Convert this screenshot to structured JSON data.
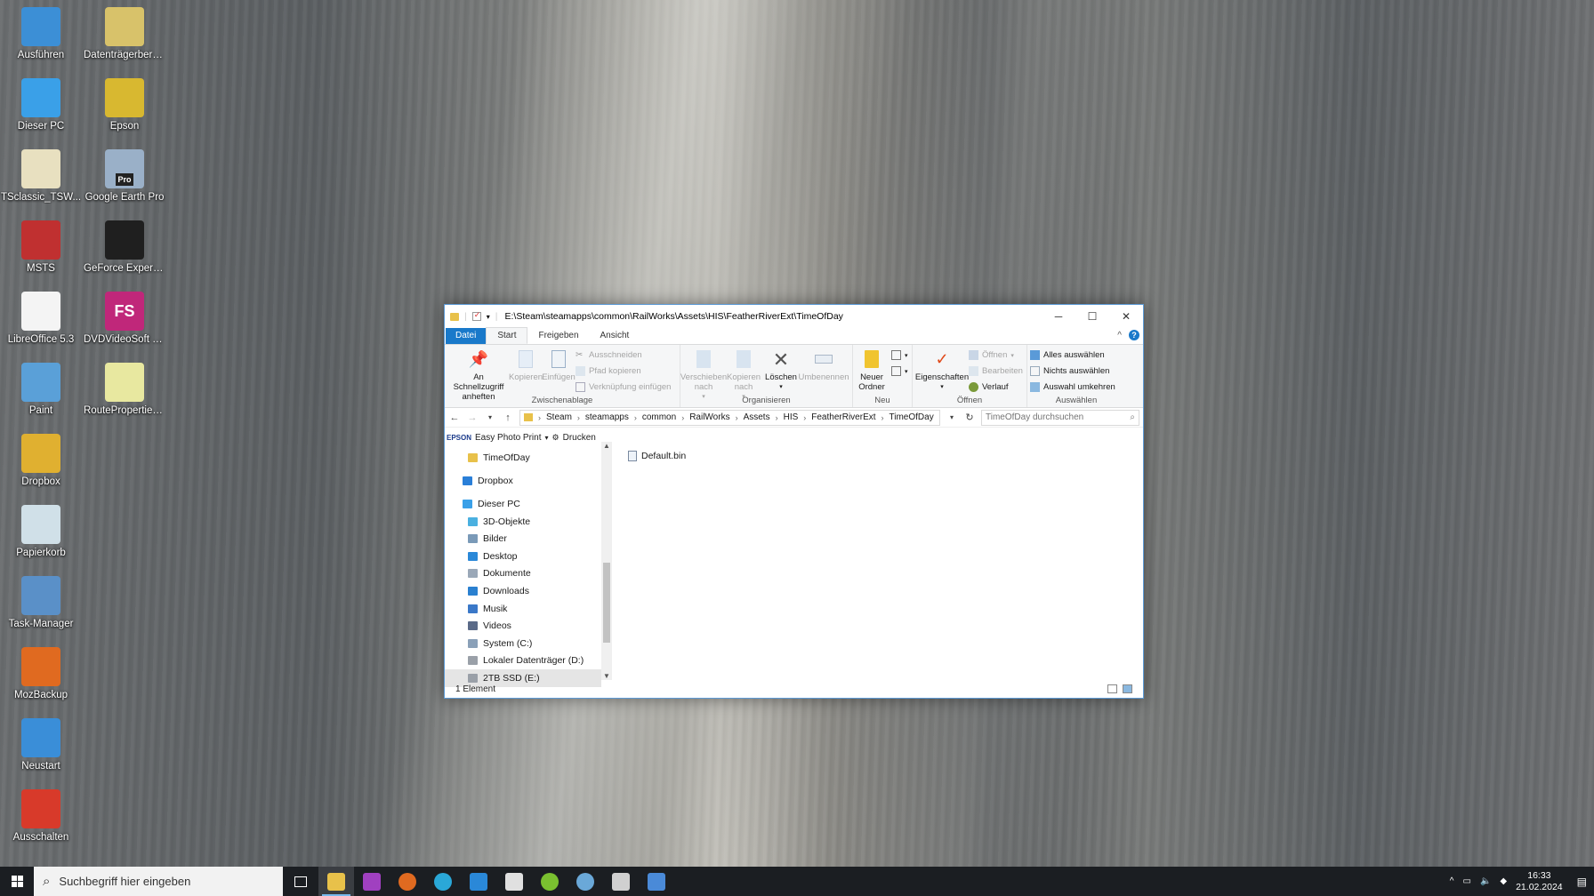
{
  "desktop": {
    "icons": [
      {
        "label": "Ausführen",
        "color": "#3c8fd6"
      },
      {
        "label": "Datenträgerberein...",
        "color": "#d8c26a"
      },
      {
        "label": "Dieser PC",
        "color": "#3aa0e8"
      },
      {
        "label": "Epson",
        "color": "#d8b830"
      },
      {
        "label": "TSclassic_TSW...",
        "color": "#e8e0c0"
      },
      {
        "label": "Google Earth Pro",
        "color": "#9ab0c8"
      },
      {
        "label": "MSTS",
        "color": "#c03030"
      },
      {
        "label": "GeForce Experience",
        "color": "#1f1f1f"
      },
      {
        "label": "LibreOffice 5.3",
        "color": "#f4f4f4"
      },
      {
        "label": "DVDVideoSoft Free Studio",
        "color": "#c0277a"
      },
      {
        "label": "Paint",
        "color": "#5aa0d8"
      },
      {
        "label": "RouteProperties.xml",
        "color": "#e8e8a0"
      },
      {
        "label": "Dropbox",
        "color": "#e0b030"
      },
      {
        "label": "Papierkorb",
        "color": "#d0e0e8"
      },
      {
        "label": "Task-Manager",
        "color": "#5a90c8"
      },
      {
        "label": "MozBackup",
        "color": "#e06a20"
      },
      {
        "label": "Neustart",
        "color": "#3a8ed8"
      },
      {
        "label": "Ausschalten",
        "color": "#d83a2a"
      }
    ],
    "fs_icon_text": "FS",
    "pro_badge": "Pro"
  },
  "window": {
    "title": "E:\\Steam\\steamapps\\common\\RailWorks\\Assets\\HIS\\FeatherRiverExt\\TimeOfDay",
    "tabs": [
      "Datei",
      "Start",
      "Freigeben",
      "Ansicht"
    ],
    "active_tab": "Start",
    "help": "?",
    "ribbon": {
      "clipboard": {
        "name": "Zwischenablage",
        "pin": "An Schnellzugriff anheften",
        "copy": "Kopieren",
        "paste": "Einfügen",
        "cut": "Ausschneiden",
        "copy_path": "Pfad kopieren",
        "paste_shortcut": "Verknüpfung einfügen"
      },
      "organize": {
        "name": "Organisieren",
        "move_to": "Verschieben nach",
        "copy_to": "Kopieren nach",
        "delete": "Löschen",
        "rename": "Umbenennen"
      },
      "new": {
        "name": "Neu",
        "new_folder": "Neuer Ordner"
      },
      "open": {
        "name": "Öffnen",
        "properties": "Eigenschaften",
        "open": "Öffnen",
        "edit": "Bearbeiten",
        "history": "Verlauf"
      },
      "select": {
        "name": "Auswählen",
        "select_all": "Alles auswählen",
        "select_none": "Nichts auswählen",
        "invert": "Auswahl umkehren"
      }
    },
    "address": [
      "Steam",
      "steamapps",
      "common",
      "RailWorks",
      "Assets",
      "HIS",
      "FeatherRiverExt",
      "TimeOfDay"
    ],
    "search_placeholder": "TimeOfDay durchsuchen",
    "epson": {
      "brand": "EPSON",
      "app": "Easy Photo Print",
      "print": "Drucken"
    },
    "nav": [
      {
        "label": "TimeOfDay",
        "icon": "folder-icon",
        "color": "#e8c14a",
        "indent": 1
      },
      {
        "label": "",
        "icon": "",
        "color": "",
        "indent": 0
      },
      {
        "label": "Dropbox",
        "icon": "dropbox-icon",
        "color": "#2a7fd8",
        "indent": 0
      },
      {
        "label": "",
        "icon": "",
        "color": "",
        "indent": 0
      },
      {
        "label": "Dieser PC",
        "icon": "pc-icon",
        "color": "#3aa0e8",
        "indent": 0
      },
      {
        "label": "3D-Objekte",
        "icon": "3d-objects-icon",
        "color": "#4ab0e0",
        "indent": 1
      },
      {
        "label": "Bilder",
        "icon": "pictures-icon",
        "color": "#7a9ab8",
        "indent": 1
      },
      {
        "label": "Desktop",
        "icon": "desktop-icon",
        "color": "#2a88d8",
        "indent": 1
      },
      {
        "label": "Dokumente",
        "icon": "documents-icon",
        "color": "#9aa8b8",
        "indent": 1
      },
      {
        "label": "Downloads",
        "icon": "downloads-icon",
        "color": "#2a80d0",
        "indent": 1
      },
      {
        "label": "Musik",
        "icon": "music-icon",
        "color": "#3a78c8",
        "indent": 1
      },
      {
        "label": "Videos",
        "icon": "videos-icon",
        "color": "#5a6a88",
        "indent": 1
      },
      {
        "label": "System (C:)",
        "icon": "drive-icon",
        "color": "#8aa0b8",
        "indent": 1
      },
      {
        "label": "Lokaler Datenträger (D:)",
        "icon": "drive-icon",
        "color": "#9aa0a8",
        "indent": 1
      },
      {
        "label": "2TB SSD (E:)",
        "icon": "drive-icon",
        "color": "#9aa0a8",
        "indent": 1,
        "selected": true
      }
    ],
    "files": [
      {
        "name": "Default.bin"
      }
    ],
    "status": "1 Element"
  },
  "taskbar": {
    "search_placeholder": "Suchbegriff hier eingeben",
    "apps": [
      {
        "name": "task-view",
        "color": "#ffffff"
      },
      {
        "name": "file-explorer",
        "color": "#e8c14a",
        "active": true
      },
      {
        "name": "mask-app",
        "color": "#a040c0"
      },
      {
        "name": "firefox",
        "color": "#e06a20"
      },
      {
        "name": "edge",
        "color": "#2aa8d8"
      },
      {
        "name": "mail",
        "color": "#2a88d8"
      },
      {
        "name": "home-app",
        "color": "#e0e0e0"
      },
      {
        "name": "green-app",
        "color": "#7ac030"
      },
      {
        "name": "steam",
        "color": "#6aa8d8"
      },
      {
        "name": "ts-app",
        "color": "#d0d0d0"
      },
      {
        "name": "blue-app",
        "color": "#4a8ad8"
      }
    ],
    "time": "16:33",
    "date": "21.02.2024"
  },
  "colors": {
    "accent": "#1979ca",
    "taskbar": "#1b1e22"
  }
}
